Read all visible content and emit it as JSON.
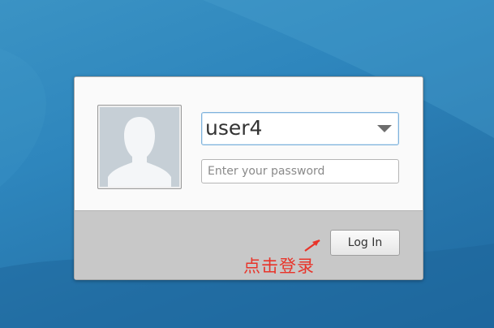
{
  "background": {
    "colors": [
      "#3b93c4",
      "#2777ad",
      "#1f6aa1"
    ]
  },
  "login": {
    "avatar_icon": "user-silhouette-icon",
    "username": {
      "value": "user4",
      "dropdown_icon": "chevron-down-icon"
    },
    "password": {
      "placeholder": "Enter your password",
      "value": ""
    },
    "login_button_label": "Log In"
  },
  "annotation": {
    "text": "点击登录",
    "color": "#e8342a",
    "arrow_icon": "arrow-pointer-icon"
  }
}
